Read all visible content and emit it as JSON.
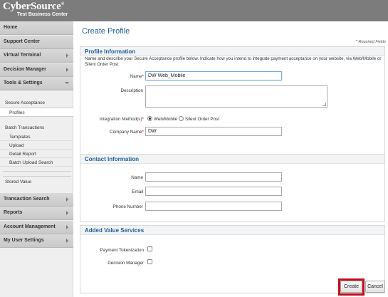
{
  "brand": {
    "name": "CyberSource",
    "sup": "®",
    "subtitle": "Test Business Center"
  },
  "sidebar": {
    "items": [
      {
        "label": "Home"
      },
      {
        "label": "Support Center"
      },
      {
        "label": "Virtual Terminal"
      },
      {
        "label": "Decision Manager"
      },
      {
        "label": "Tools & Settings"
      }
    ],
    "sub_groups": {
      "secure_acceptance": "Secure Acceptance",
      "profiles": "Profiles",
      "batch_transactions": "Batch Transactions",
      "templates": "Templates",
      "upload": "Upload",
      "detail_report": "Detail Report",
      "batch_upload_search": "Batch Upload Search",
      "stored_value": "Stored Value"
    },
    "bottom_items": [
      {
        "label": "Transaction Search"
      },
      {
        "label": "Reports"
      },
      {
        "label": "Account Management"
      },
      {
        "label": "My User Settings"
      }
    ]
  },
  "page": {
    "title": "Create Profile",
    "required_note": "Required Fields",
    "required_star": "*"
  },
  "profile_info": {
    "heading": "Profile Information",
    "description": "Name and describe your Secure Acceptance profile below. Indicate how you intend to integrate payment acceptance on your website, via Web/Mobile or Silent Order Post.",
    "name_label": "Name",
    "name_value": "DW Web_Mobile",
    "description_label": "Description",
    "integration_label": "Integration Method(s)",
    "option_web_mobile": "Web/Mobile",
    "option_silent_order_post": "Silent Order Post",
    "company_label": "Company Name",
    "company_value": "DW"
  },
  "contact_info": {
    "heading": "Contact Information",
    "name_label": "Name",
    "email_label": "Email",
    "phone_label": "Phone Number"
  },
  "value_services": {
    "heading": "Added Value Services",
    "tokenization_label": "Payment Tokenization",
    "decision_manager_label": "Decision Manager"
  },
  "actions": {
    "create": "Create",
    "cancel": "Cancel"
  }
}
